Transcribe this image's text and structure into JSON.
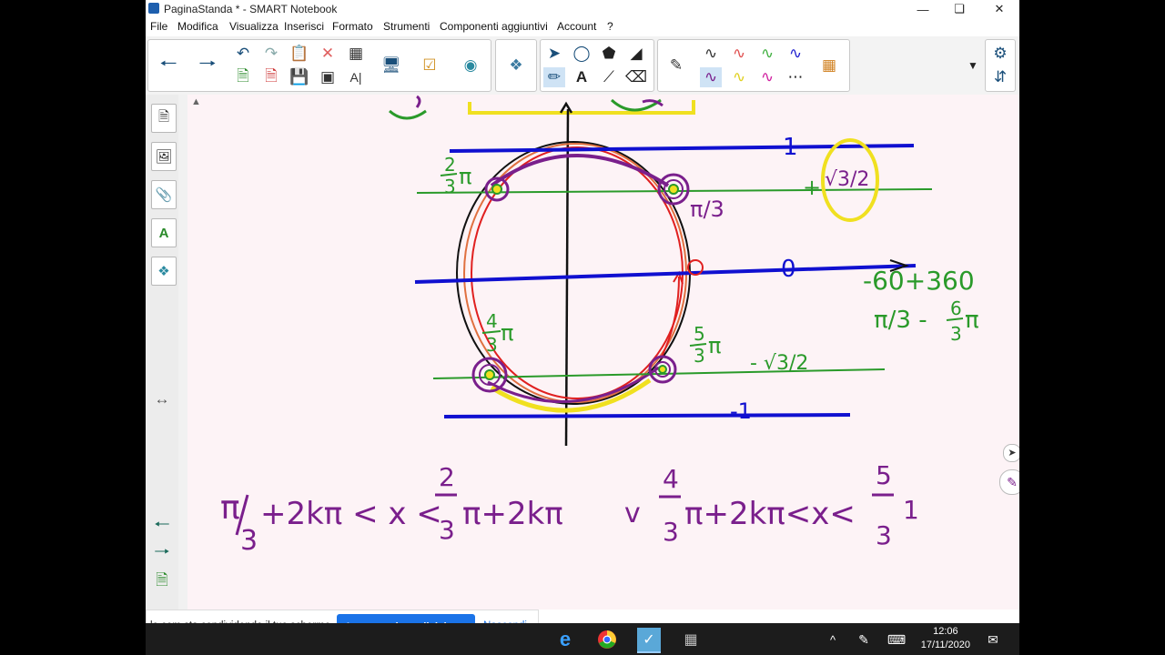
{
  "window": {
    "title": "PaginaStanda * - SMART Notebook"
  },
  "menu": [
    "File",
    "Modifica",
    "Visualizza",
    "Inserisci",
    "Formato",
    "Strumenti",
    "Componenti aggiuntivi",
    "Account",
    "?"
  ],
  "canvas": {
    "label_1": "1",
    "label_0": "0",
    "label_minus1": "-1",
    "label_2_3pi_num": "2",
    "label_2_3pi_den": "3",
    "label_2_3pi_sym": "π",
    "label_pi3": "π/3",
    "label_plus": "+",
    "label_sqrt3_2": "√3/2",
    "label_4_3pi_num": "4",
    "label_4_3pi_den": "3",
    "label_4_3pi_sym": "π",
    "label_5_3pi_num": "5",
    "label_5_3pi_den": "3",
    "label_5_3pi_sym": "π",
    "label_minus_sqrt3_2": "- √3/2",
    "note_line1": "-60+360",
    "note_line2_a": "π/3 -",
    "note_line2_num": "6",
    "note_line2_den": "3",
    "note_line2_pi": "π",
    "formula_pi": "π",
    "formula_slash_den": "3",
    "formula_part1": "+2kπ < x <",
    "formula_frac1_num": "2",
    "formula_frac1_den": "3",
    "formula_part2": "π+2kπ",
    "formula_or": "v",
    "formula_frac2_num": "4",
    "formula_frac2_den": "3",
    "formula_part3": "π+2kπ<x<",
    "formula_frac3_num": "5",
    "formula_frac3_den": "3",
    "formula_tail": "1"
  },
  "share_bar": {
    "text": "le.com sta condividendo il tuo schermo.",
    "stop_button": "Interrompi condivisione",
    "hide_link": "Nascondi"
  },
  "clock": {
    "time": "12:06",
    "date": "17/11/2020"
  },
  "colors": {
    "green": "#2a9a2a",
    "purple": "#7a1f8c",
    "blue": "#1010d0",
    "red": "#e02020",
    "yellow": "#f0e020"
  }
}
